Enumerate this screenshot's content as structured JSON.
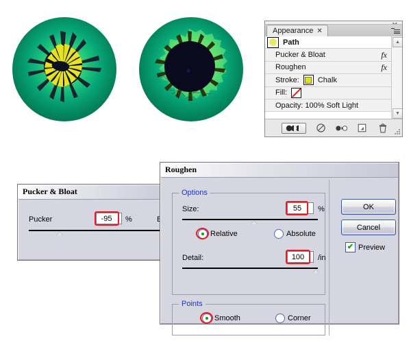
{
  "artwork": {
    "name": "illustrator-eye-artwork",
    "eyes": [
      {
        "name": "eye-pucker-bloat-result",
        "description": "Green iris with yellow spiked pupil",
        "iris_outer_color": "#05523a",
        "iris_inner_color": "#7ef06a",
        "pupil_color": "#0a0a1e",
        "spike_color": "#e8e320"
      },
      {
        "name": "eye-roughen-result",
        "description": "Green iris with round black pupil and dark spikes",
        "iris_outer_color": "#05523a",
        "iris_inner_color": "#8df56d",
        "pupil_color": "#0a0a1e",
        "spike_color": "#2b3a12"
      }
    ]
  },
  "appearance_panel": {
    "tab_label": "Appearance",
    "tab_close_glyph": "✕",
    "minimize_glyph": "–",
    "close_glyph": "✕",
    "rows": [
      {
        "label": "Path",
        "type": "header",
        "fx": ""
      },
      {
        "label": "Pucker & Bloat",
        "type": "effect",
        "fx": "fx"
      },
      {
        "label": "Roughen",
        "type": "effect",
        "fx": "fx"
      },
      {
        "label": "Stroke:",
        "type": "stroke",
        "value": "Chalk",
        "swatch": "yellow-swatch"
      },
      {
        "label": "Fill:",
        "type": "fill",
        "value": "",
        "swatch": "none-swatch"
      },
      {
        "label": "Opacity: 100% Soft Light",
        "type": "opacity",
        "fx": ""
      }
    ],
    "footer_buttons": [
      {
        "name": "toggle-effects-button",
        "icon": "three-circles-icon"
      },
      {
        "name": "clear-appearance-button",
        "icon": "no-entry-icon"
      },
      {
        "name": "reduce-to-basic-appearance-button",
        "icon": "circle-arrow-circle-icon"
      },
      {
        "name": "duplicate-item-button",
        "icon": "duplicate-page-icon"
      },
      {
        "name": "delete-item-button",
        "icon": "trash-icon"
      }
    ]
  },
  "pucker_dialog": {
    "title": "Pucker & Bloat",
    "left_label": "Pucker",
    "right_label": "Bloat",
    "value": "-95",
    "unit": "%"
  },
  "roughen_dialog": {
    "title": "Roughen",
    "options_legend": "Options",
    "size_label": "Size:",
    "size_value": "55",
    "size_unit": "%",
    "relative_label": "Relative",
    "absolute_label": "Absolute",
    "size_mode_selected": "Relative",
    "detail_label": "Detail:",
    "detail_value": "100",
    "detail_unit": "/in",
    "points_legend": "Points",
    "smooth_label": "Smooth",
    "corner_label": "Corner",
    "points_selected": "Smooth",
    "ok_label": "OK",
    "cancel_label": "Cancel",
    "preview_label": "Preview",
    "preview_checked": true,
    "check_glyph": "✔"
  },
  "colors": {
    "highlight_red": "#ee1c22",
    "legend_blue": "#1c35c8",
    "dialog_face": "#d6d6e0",
    "radio_green": "#12a012"
  }
}
